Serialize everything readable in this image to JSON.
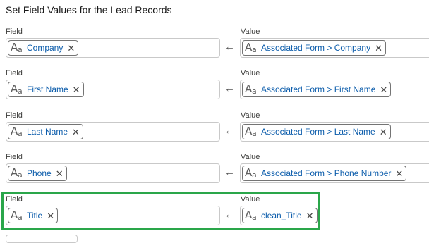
{
  "title": "Set Field Values for the Lead Records",
  "field_label": "Field",
  "value_label": "Value",
  "type_icon": "text-field-icon",
  "arrow_icon": "left-arrow-icon",
  "highlight_color": "#2aa64a",
  "rows": [
    {
      "field": "Company",
      "value": "Associated Form > Company"
    },
    {
      "field": "First Name",
      "value": "Associated Form > First Name"
    },
    {
      "field": "Last Name",
      "value": "Associated Form > Last Name"
    },
    {
      "field": "Phone",
      "value": "Associated Form > Phone Number"
    },
    {
      "field": "Title",
      "value": "clean_Title"
    }
  ]
}
